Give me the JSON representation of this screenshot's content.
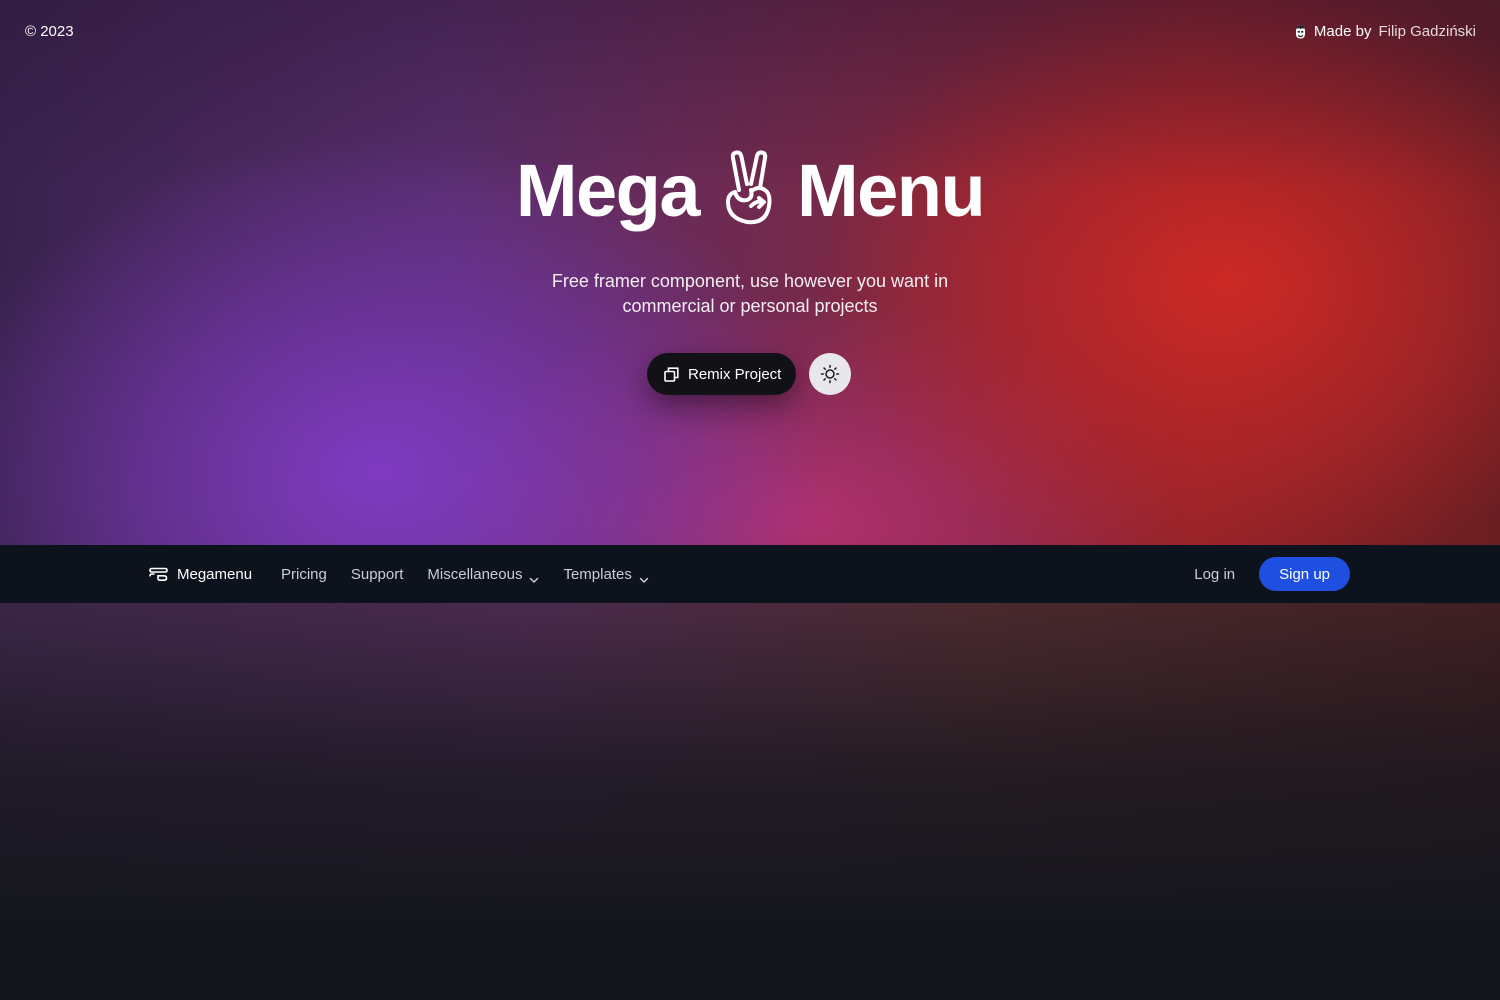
{
  "corner": {
    "copyright": "© 2023",
    "made_by_label": "Made by",
    "author": "Filip Gadziński",
    "author_icon": "face-icon"
  },
  "hero": {
    "title_left": "Mega",
    "title_icon": "peace-hand-icon",
    "title_right": "Menu",
    "subtitle_line1": "Free framer component, use however you want in",
    "subtitle_line2": "commercial or personal projects",
    "remix_label": "Remix Project",
    "remix_icon": "copy-icon",
    "theme_icon": "sun-icon"
  },
  "navbar": {
    "brand": "Megamenu",
    "brand_icon": "megamenu-logo-icon",
    "links": [
      {
        "label": "Pricing",
        "dropdown": false
      },
      {
        "label": "Support",
        "dropdown": false
      },
      {
        "label": "Miscellaneous",
        "dropdown": true
      },
      {
        "label": "Templates",
        "dropdown": true
      }
    ],
    "login_label": "Log in",
    "signup_label": "Sign up"
  },
  "colors": {
    "navbar_bg": "#0d131d",
    "signup_bg": "#1f4fe0",
    "remix_bg": "#121216",
    "theme_btn_bg": "#e9e6ec"
  }
}
